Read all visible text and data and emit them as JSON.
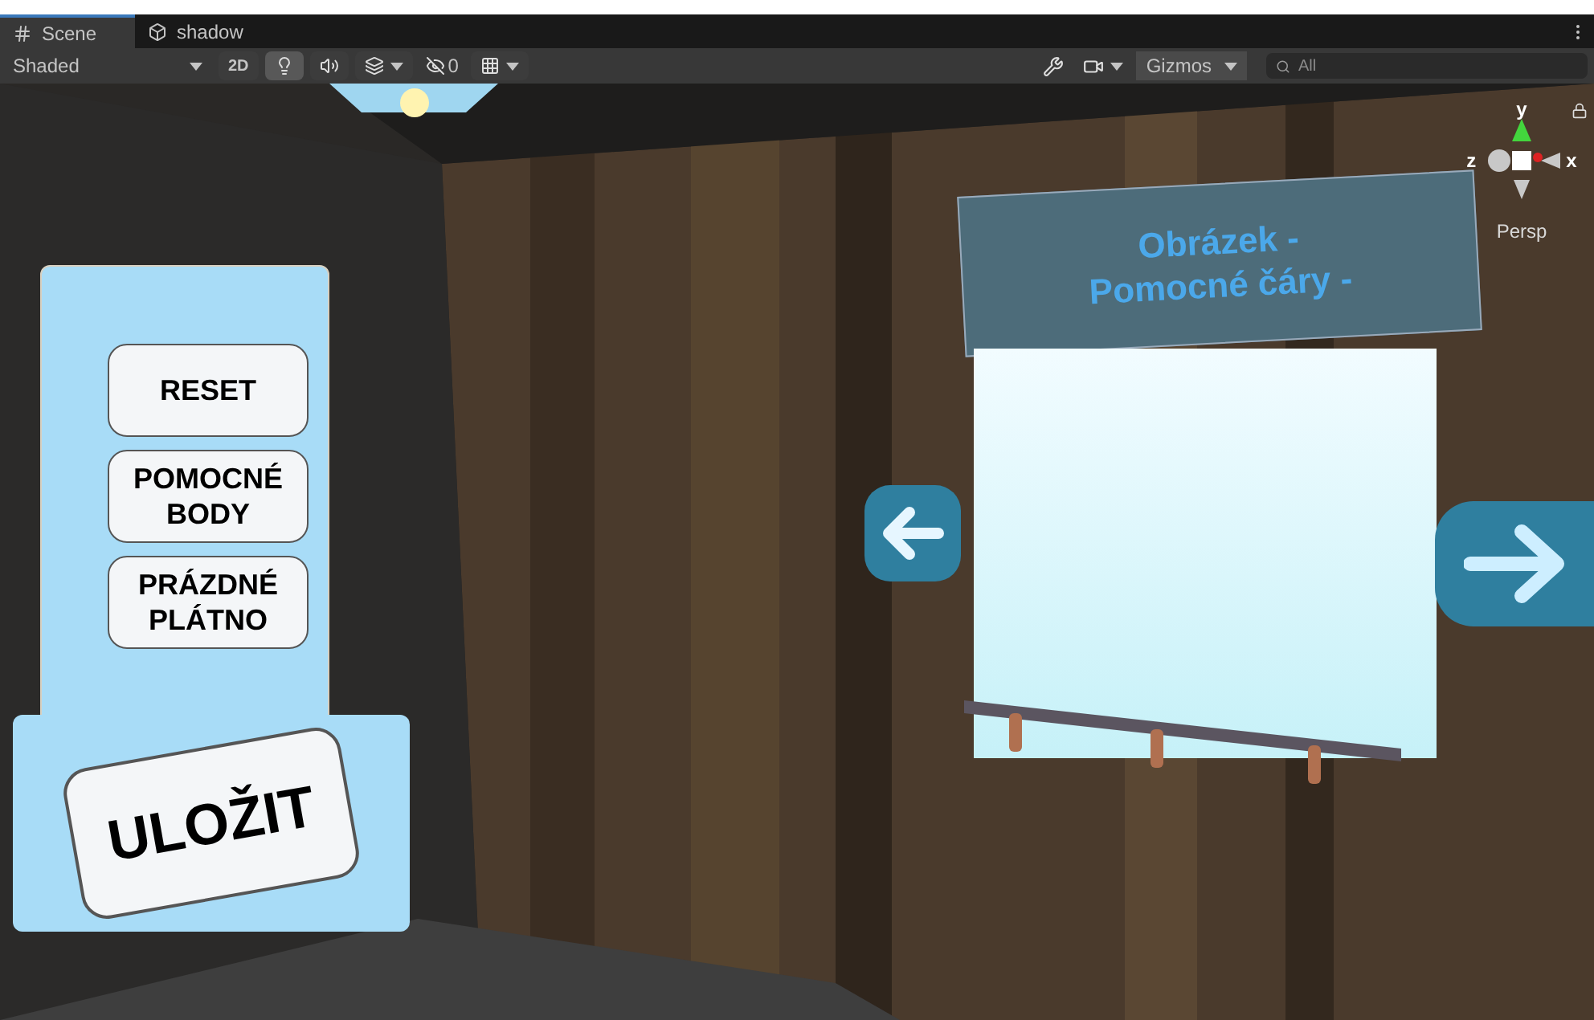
{
  "tabs": [
    {
      "label": "Scene",
      "kind": "scene",
      "selected": true
    },
    {
      "label": "shadow",
      "kind": "prefab",
      "selected": false
    }
  ],
  "toolbar": {
    "shading": {
      "label": "Shaded"
    },
    "mode_2d": {
      "label": "2D",
      "selected": false
    },
    "lighting": {
      "selected": true
    },
    "audio": {
      "selected": false
    },
    "effects": {
      "selected": false
    },
    "hidden_count": "0",
    "grid": {
      "selected": false
    },
    "gizmos": {
      "label": "Gizmos",
      "selected": true
    },
    "search": {
      "placeholder": "All"
    }
  },
  "scene": {
    "side_panel_buttons": [
      {
        "label": "RESET"
      },
      {
        "label": "POMOCNÉ BODY"
      },
      {
        "label": "PRÁZDNÉ PLÁTNO"
      }
    ],
    "save_button": {
      "label": "ULOŽIT"
    },
    "title_sign": [
      "Obrázek -",
      "Pomocné čáry -"
    ],
    "gizmo": {
      "y": "y",
      "z": "z",
      "x": "x",
      "projection": "Persp"
    }
  }
}
